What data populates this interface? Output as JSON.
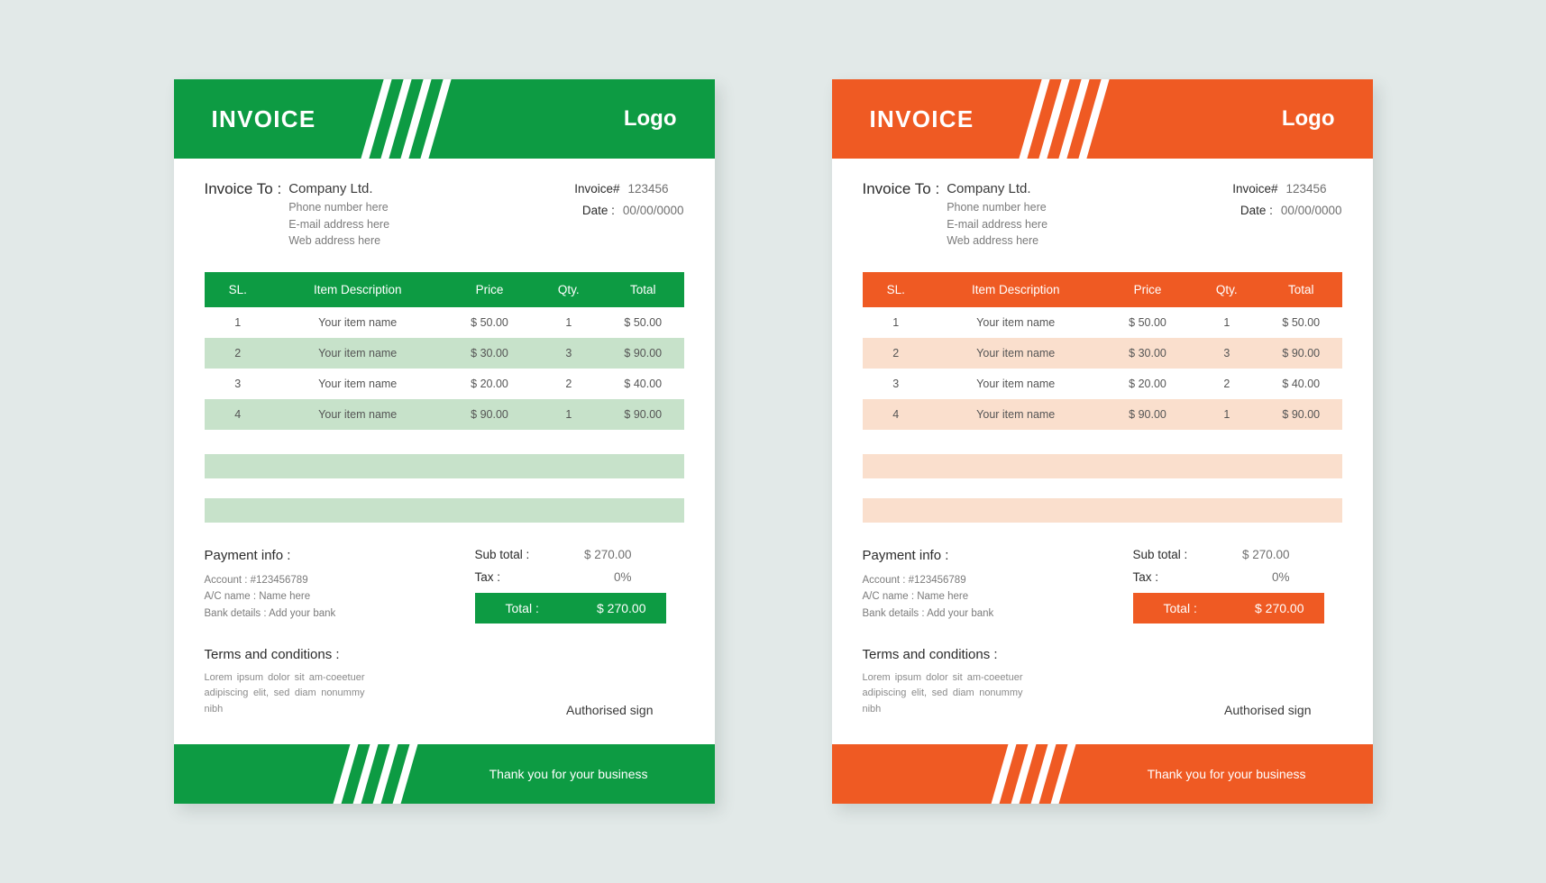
{
  "page": {
    "background_color": "#e2e9e8"
  },
  "themes": {
    "green": {
      "accent": "#0d9b43",
      "row_alt": "#c7e2ca",
      "filler": "#c7e2ca"
    },
    "orange": {
      "accent": "#ef5a23",
      "row_alt": "#fadfcd",
      "filler": "#fadfcd"
    }
  },
  "invoice": {
    "header": {
      "title": "INVOICE",
      "logo": "Logo"
    },
    "bill_to": {
      "label": "Invoice To :",
      "company": "Company Ltd.",
      "lines": [
        "Phone number here",
        "E-mail address here",
        "Web address here"
      ]
    },
    "meta": [
      {
        "key": "Invoice#",
        "value": "123456"
      },
      {
        "key": "Date :",
        "value": "00/00/0000"
      }
    ],
    "table": {
      "columns": [
        "SL.",
        "Item Description",
        "Price",
        "Qty.",
        "Total"
      ],
      "rows": [
        {
          "sl": "1",
          "desc": "Your item name",
          "price": "$ 50.00",
          "qty": "1",
          "total": "$ 50.00"
        },
        {
          "sl": "2",
          "desc": "Your item name",
          "price": "$ 30.00",
          "qty": "3",
          "total": "$ 90.00"
        },
        {
          "sl": "3",
          "desc": "Your item name",
          "price": "$ 20.00",
          "qty": "2",
          "total": "$ 40.00"
        },
        {
          "sl": "4",
          "desc": "Your item name",
          "price": "$ 90.00",
          "qty": "1",
          "total": "$ 90.00"
        }
      ]
    },
    "payment": {
      "title": "Payment info :",
      "lines": [
        "Account :  #123456789",
        "A/C name :  Name here",
        "Bank details :  Add your bank"
      ]
    },
    "totals": {
      "sub_total_label": "Sub total :",
      "sub_total_value": "$ 270.00",
      "tax_label": "Tax :",
      "tax_value": "0%",
      "total_label": "Total :",
      "total_value": "$ 270.00"
    },
    "terms": {
      "title": "Terms and conditions :",
      "text": "Lorem ipsum dolor sit am-coeetuer adipiscing elit, sed diam nonummy nibh",
      "sign": "Authorised sign"
    },
    "footer": {
      "text": "Thank you for your business"
    }
  }
}
